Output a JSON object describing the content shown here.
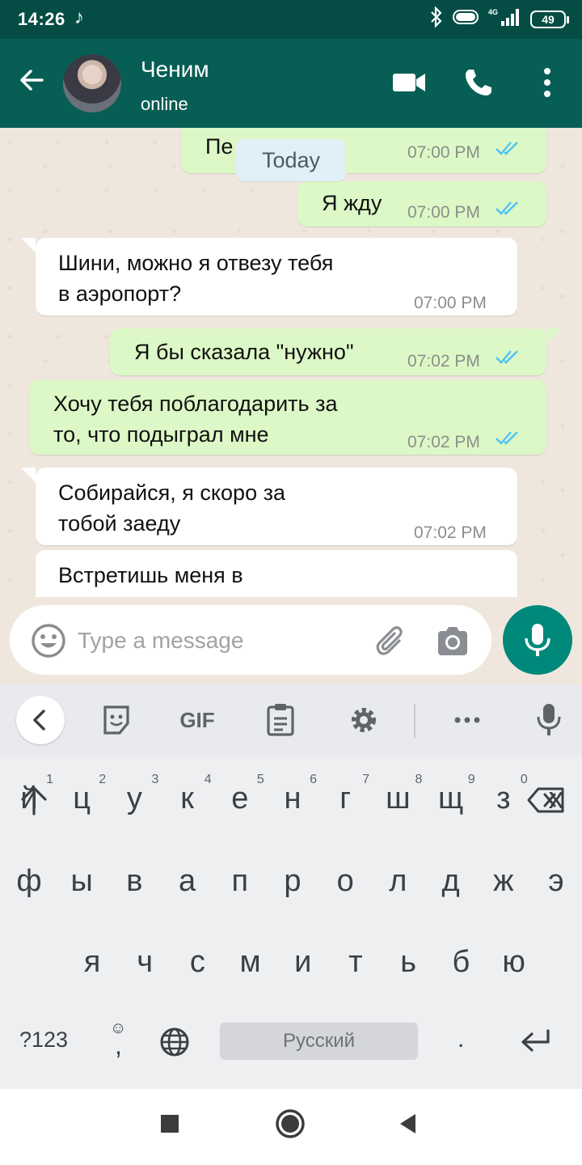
{
  "status_bar": {
    "time": "14:26",
    "battery": "49",
    "network": "4G"
  },
  "header": {
    "contact_name": "Ченим",
    "contact_status": "online"
  },
  "chat": {
    "date_chip": "Today",
    "messages": [
      {
        "direction": "out",
        "text": "Пе          мне",
        "time": "07:00 PM",
        "status": "read"
      },
      {
        "direction": "out",
        "text": "Я жду",
        "time": "07:00 PM",
        "status": "read"
      },
      {
        "direction": "in",
        "text": "Шини, можно я отвезу тебя\nв аэропорт?",
        "time": "07:00 PM"
      },
      {
        "direction": "out",
        "text": "Я бы сказала \"нужно\"",
        "time": "07:02 PM",
        "status": "read"
      },
      {
        "direction": "out",
        "text": "Хочу тебя поблагодарить за\nто, что подыграл мне",
        "time": "07:02 PM",
        "status": "read"
      },
      {
        "direction": "in",
        "text": "Собирайся, я скоро за\nтобой заеду",
        "time": "07:02 PM"
      },
      {
        "direction": "in",
        "text": "Встретишь меня в",
        "time": ""
      }
    ]
  },
  "composer": {
    "placeholder": "Type a message"
  },
  "keyboard": {
    "toolbar": {
      "gif_label": "GIF"
    },
    "row1": [
      "й",
      "ц",
      "у",
      "к",
      "е",
      "н",
      "г",
      "ш",
      "щ",
      "з",
      "х"
    ],
    "row1_hints": [
      "1",
      "2",
      "3",
      "4",
      "5",
      "6",
      "7",
      "8",
      "9",
      "0",
      ""
    ],
    "row2": [
      "ф",
      "ы",
      "в",
      "а",
      "п",
      "р",
      "о",
      "л",
      "д",
      "ж",
      "э"
    ],
    "row3": [
      "я",
      "ч",
      "с",
      "м",
      "и",
      "т",
      "ь",
      "б",
      "ю"
    ],
    "symbols_label": "?123",
    "comma_label": ",",
    "space_label": "Русский",
    "period_label": "."
  },
  "colors": {
    "header": "#075e54",
    "outgoing": "#dcf8c6",
    "incoming": "#ffffff",
    "read_ticks": "#4fc3f7",
    "mic": "#00897b"
  }
}
